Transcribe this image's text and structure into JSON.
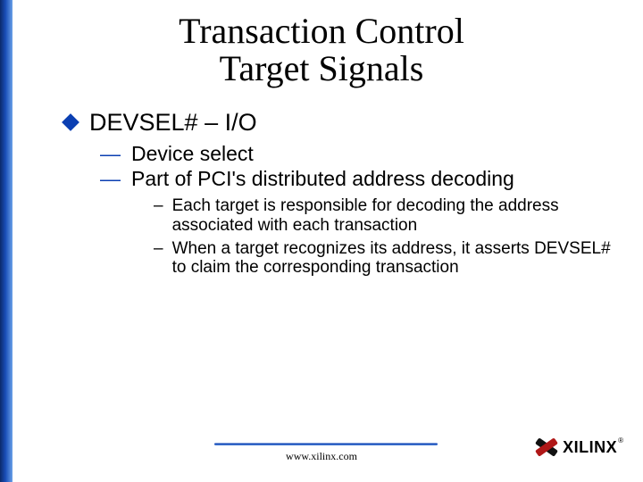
{
  "title": {
    "line1": "Transaction Control",
    "line2": "Target Signals"
  },
  "bullets": {
    "l1": "DEVSEL# – I/O",
    "l2_1": "Device select",
    "l2_2": "Part of PCI's distributed address decoding",
    "l3_1": "Each target is responsible for decoding the address associated with each transaction",
    "l3_2": "When a target recognizes its address, it asserts DEVSEL# to claim the corresponding transaction"
  },
  "footer": {
    "url": "www.xilinx.com",
    "brand": "XILINX",
    "reg": "®"
  }
}
